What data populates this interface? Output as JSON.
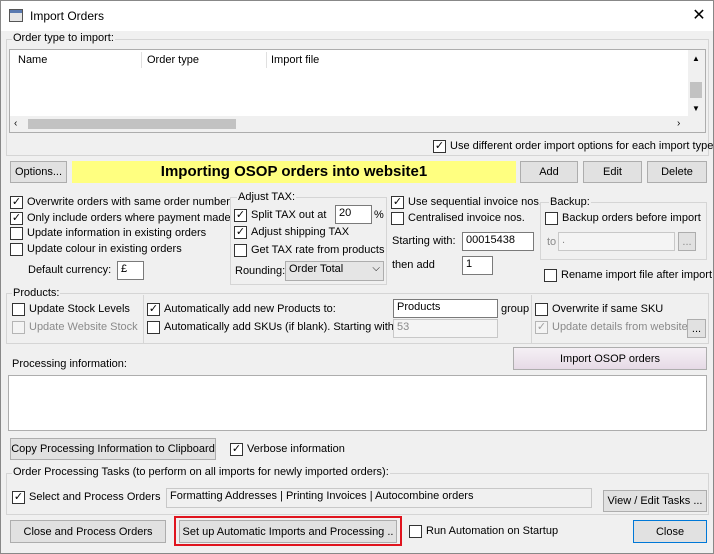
{
  "window": {
    "title": "Import Orders",
    "close_glyph": "✕"
  },
  "order_type": {
    "group_label": "Order type to import:",
    "columns": [
      "Name",
      "Order type",
      "Import file"
    ],
    "use_different_label": "Use different order import options for each import type",
    "use_different_checked": true
  },
  "toolbar": {
    "options_label": "Options...",
    "banner_text": "Importing OSOP orders into website1",
    "add_label": "Add",
    "edit_label": "Edit",
    "delete_label": "Delete"
  },
  "options_left": {
    "overwrite_label": "Overwrite orders with same order number",
    "only_include_label": "Only include orders where payment made",
    "update_info_label": "Update information in existing orders",
    "update_colour_label": "Update colour in existing orders",
    "default_currency_label": "Default currency:",
    "default_currency_value": "£"
  },
  "adjust_tax": {
    "group_label": "Adjust TAX:",
    "split_label": "Split TAX out at",
    "split_value": "20",
    "percent_label": "%",
    "shipping_label": "Adjust shipping TAX",
    "rate_label": "Get TAX rate from products",
    "rounding_label": "Rounding:",
    "rounding_value": "Order Total"
  },
  "invoice": {
    "sequential_label": "Use sequential invoice nos.",
    "centralised_label": "Centralised invoice nos.",
    "starting_label": "Starting with:",
    "starting_value": "00015438",
    "then_add_label": "then add",
    "then_add_value": "1"
  },
  "backup": {
    "group_label": "Backup:",
    "backup_label": "Backup orders before import",
    "to_label": "to",
    "to_value": ".",
    "browse_label": "...",
    "rename_label": "Rename import file after import"
  },
  "products": {
    "group_label": "Products:",
    "update_stock_label": "Update Stock Levels",
    "update_website_label": "Update Website Stock",
    "auto_add_label": "Automatically add new Products to:",
    "auto_add_value": "Products",
    "group_suffix": "group",
    "auto_skus_label": "Automatically add SKUs (if blank). Starting with:",
    "auto_skus_value": "53",
    "overwrite_sku_label": "Overwrite if same SKU",
    "update_details_label": "Update details from website",
    "details_browse_label": "..."
  },
  "processing": {
    "info_label": "Processing information:",
    "import_button_label": "Import OSOP orders",
    "copy_button_label": "Copy Processing Information to Clipboard",
    "verbose_label": "Verbose information"
  },
  "tasks": {
    "group_label": "Order Processing Tasks (to perform on all imports for newly imported orders):",
    "select_process_label": "Select and Process Orders",
    "tasks_value": "Formatting Addresses | Printing Invoices | Autocombine orders",
    "view_edit_label": "View / Edit Tasks ..."
  },
  "footer": {
    "close_process_label": "Close and Process Orders",
    "setup_auto_label": "Set up Automatic Imports and Processing ..",
    "run_auto_label": "Run Automation on Startup",
    "close_label": "Close"
  },
  "colors": {
    "banner": "#ffff80",
    "highlight": "#e0141e"
  }
}
